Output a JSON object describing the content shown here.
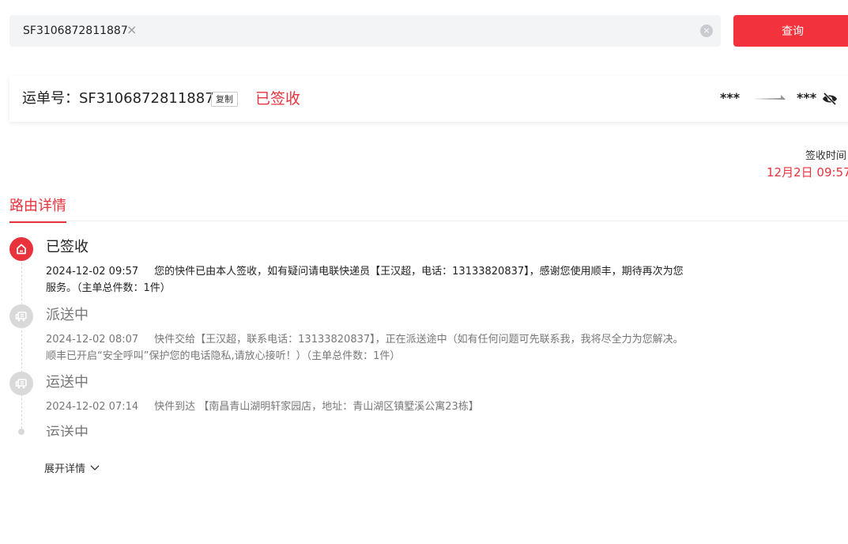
{
  "search": {
    "tag_value": "SF3106872811887",
    "tag_close_glyph": "×",
    "clear_glyph": "×",
    "query_label": "查询"
  },
  "waybill": {
    "label": "运单号：SF3106872811887",
    "copy_label": "复制",
    "status": "已签收",
    "origin": "***",
    "destination": "***",
    "privacy_icon": "eye-off-icon"
  },
  "sign_time": {
    "label": "签收时间",
    "value": "12月2日 09:57"
  },
  "tabs": {
    "route_details": "路由详情"
  },
  "timeline": [
    {
      "icon": "home-icon",
      "title": "已签收",
      "time": "2024-12-02 09:57",
      "line1": "您的快件已由本人签收，如有疑问请电联快递员【王汉超，电话：13133820837】，感谢您使用顺丰，期待再次为您",
      "line2": "服务。（主单总件数：1件）"
    },
    {
      "icon": "delivery-truck-icon",
      "title": "派送中",
      "time": "2024-12-02 08:07",
      "line1": "快件交给【王汉超，联系电话：13133820837】，正在派送途中（如有任何问题可先联系我，我将尽全力为您解决。",
      "line2": "顺丰已开启“安全呼叫”保护您的电话隐私,请放心接听！）（主单总件数：1件）"
    },
    {
      "icon": "delivery-truck-icon",
      "title": "运送中",
      "time": "2024-12-02 07:14",
      "line1": "快件到达 【南昌青山湖明轩家园店，地址：青山湖区镇墅溪公寓23栋】"
    },
    {
      "icon": "dot",
      "title": "运送中"
    }
  ],
  "expand": {
    "label": "展开详情"
  },
  "colors": {
    "accent": "#e8333c",
    "button": "#f2323c",
    "muted_text": "#777777",
    "icon_gray": "#d9d9d9"
  }
}
